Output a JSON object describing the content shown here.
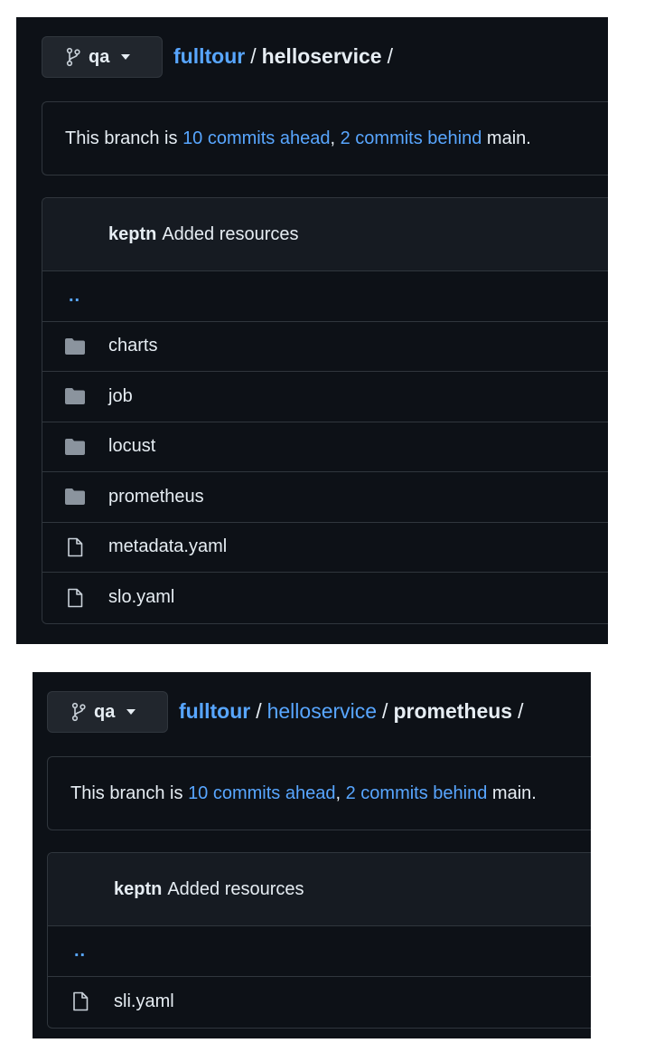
{
  "colors": {
    "background": "#0d1117",
    "link": "#58a6ff",
    "text": "#e6edf3",
    "border": "#30363d"
  },
  "panels": [
    {
      "branch": {
        "icon": "git-branch-icon",
        "label": "qa"
      },
      "breadcrumb": {
        "repo": "fulltour",
        "path": [
          "helloservice"
        ]
      },
      "notice": {
        "prefix": "This branch is ",
        "ahead": "10 commits ahead",
        "comma": ", ",
        "behind": "2 commits behind",
        "suffix": " main."
      },
      "commit": {
        "author": "keptn",
        "message": "Added resources"
      },
      "parent_link": "..",
      "entries": [
        {
          "type": "folder",
          "icon": "folder-icon",
          "name": "charts"
        },
        {
          "type": "folder",
          "icon": "folder-icon",
          "name": "job"
        },
        {
          "type": "folder",
          "icon": "folder-icon",
          "name": "locust"
        },
        {
          "type": "folder",
          "icon": "folder-icon",
          "name": "prometheus"
        },
        {
          "type": "file",
          "icon": "file-icon",
          "name": "metadata.yaml"
        },
        {
          "type": "file",
          "icon": "file-icon",
          "name": "slo.yaml"
        }
      ]
    },
    {
      "branch": {
        "icon": "git-branch-icon",
        "label": "qa"
      },
      "breadcrumb": {
        "repo": "fulltour",
        "path": [
          "helloservice",
          "prometheus"
        ]
      },
      "notice": {
        "prefix": "This branch is ",
        "ahead": "10 commits ahead",
        "comma": ", ",
        "behind": "2 commits behind",
        "suffix": " main."
      },
      "commit": {
        "author": "keptn",
        "message": "Added resources"
      },
      "parent_link": "..",
      "entries": [
        {
          "type": "file",
          "icon": "file-icon",
          "name": "sli.yaml"
        }
      ]
    }
  ]
}
